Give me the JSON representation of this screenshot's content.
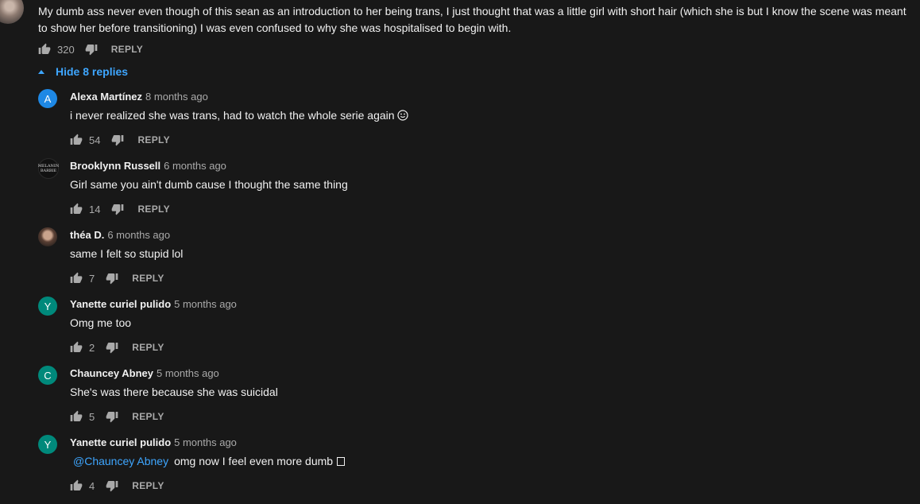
{
  "top_comment": {
    "text": "My dumb ass never even though of this sean as an introduction to her being trans, I just thought that was a little girl with short hair (which she is but I know the scene was meant to show her before transitioning) I was even confused to why she was hospitalised to begin with.",
    "likes": "320",
    "reply_label": "REPLY"
  },
  "hide_replies_label": "Hide 8 replies",
  "replies": [
    {
      "author": "Alexa Martínez",
      "time": "8 months ago",
      "text": "i never realized she was trans, had to watch the whole serie again",
      "likes": "54",
      "reply_label": "REPLY",
      "avatar_letter": "A",
      "avatar_color": "#1e88e5"
    },
    {
      "author": "Brooklynn Russell",
      "time": "6 months ago",
      "text": "Girl same you ain't dumb cause I thought the same thing",
      "likes": "14",
      "reply_label": "REPLY",
      "avatar_text": "MELANIN BARBIE"
    },
    {
      "author": "théa D.",
      "time": "6 months ago",
      "text": "same I felt so stupid lol",
      "likes": "7",
      "reply_label": "REPLY"
    },
    {
      "author": "Yanette curiel pulido",
      "time": "5 months ago",
      "text": "Omg me too",
      "likes": "2",
      "reply_label": "REPLY",
      "avatar_letter": "Y",
      "avatar_color": "#00897b"
    },
    {
      "author": "Chauncey Abney",
      "time": "5 months ago",
      "text": "She's was there because she was suicidal",
      "likes": "5",
      "reply_label": "REPLY",
      "avatar_letter": "C",
      "avatar_color": "#00897b"
    },
    {
      "author": "Yanette curiel pulido",
      "time": "5 months ago",
      "mention": "@Chauncey Abney",
      "text": "omg now I feel even more dumb",
      "likes": "4",
      "reply_label": "REPLY",
      "avatar_letter": "Y",
      "avatar_color": "#00897b"
    }
  ]
}
